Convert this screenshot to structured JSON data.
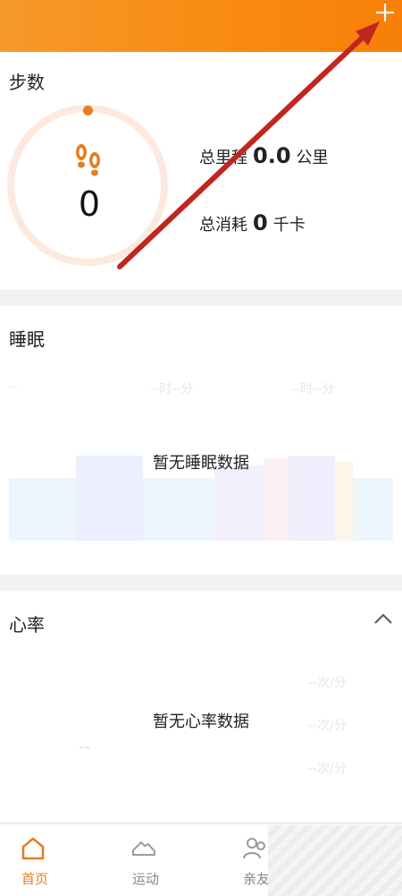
{
  "colors": {
    "accent": "#e67e22",
    "header": "#f98a10",
    "arrow": "#c0261f"
  },
  "header": {
    "add_icon": "plus-icon"
  },
  "steps": {
    "title": "步数",
    "count": "0",
    "icon": "footprints-icon",
    "distance_label": "总里程",
    "distance_value": "0.0",
    "distance_unit": "公里",
    "calories_label": "总消耗",
    "calories_value": "0",
    "calories_unit": "千卡"
  },
  "sleep": {
    "title": "睡眠",
    "placeholders": [
      "--",
      "--时--分",
      "--时--分"
    ],
    "empty_text": "暂无睡眠数据"
  },
  "heart": {
    "title": "心率",
    "toggle_icon": "chevron-up-icon",
    "placeholder": "--",
    "rows": [
      "--次/分",
      "--次/分",
      "--次/分"
    ],
    "empty_text": "暂无心率数据"
  },
  "tabs": [
    {
      "label": "首页",
      "icon": "home-icon",
      "active": true
    },
    {
      "label": "运动",
      "icon": "sneaker-icon",
      "active": false
    },
    {
      "label": "亲友",
      "icon": "people-icon",
      "active": false
    }
  ]
}
